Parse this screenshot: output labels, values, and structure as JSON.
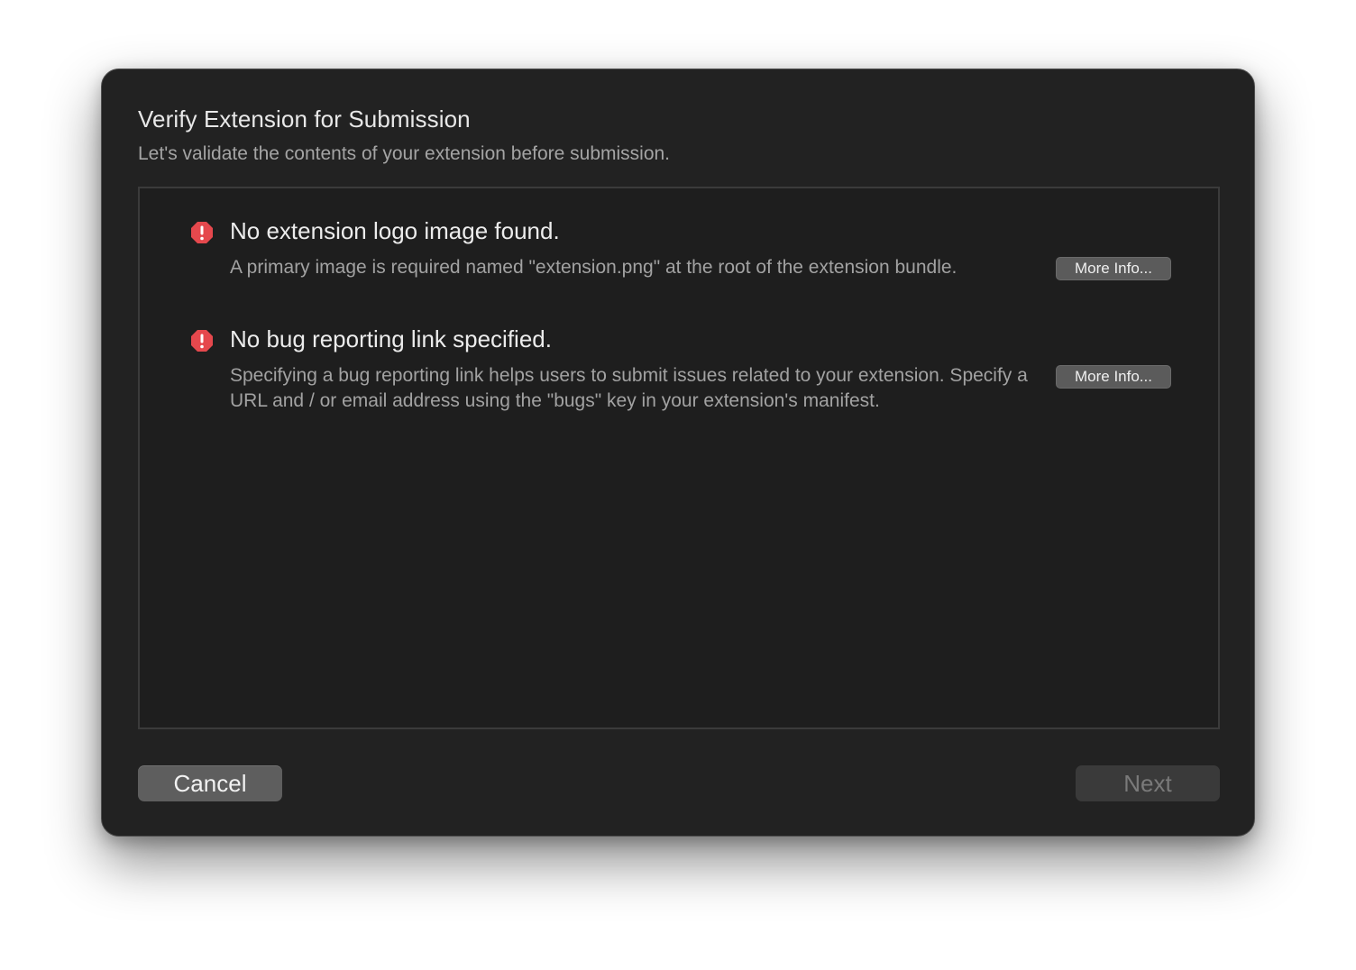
{
  "dialog": {
    "title": "Verify Extension for Submission",
    "subtitle": "Let's validate the contents of your extension before submission."
  },
  "issues": [
    {
      "icon": "error-icon",
      "title": "No extension logo image found.",
      "description": "A primary image is required named \"extension.png\" at the root of the extension bundle.",
      "button_label": "More Info..."
    },
    {
      "icon": "error-icon",
      "title": "No bug reporting link specified.",
      "description": "Specifying a bug reporting link helps users to submit issues related to your extension. Specify a URL and / or email address using the \"bugs\" key in your extension's manifest.",
      "button_label": "More Info..."
    }
  ],
  "footer": {
    "cancel_label": "Cancel",
    "next_label": "Next"
  },
  "colors": {
    "error": "#e5484d",
    "dialog_background": "#222222",
    "panel_background": "#1e1e1e"
  }
}
